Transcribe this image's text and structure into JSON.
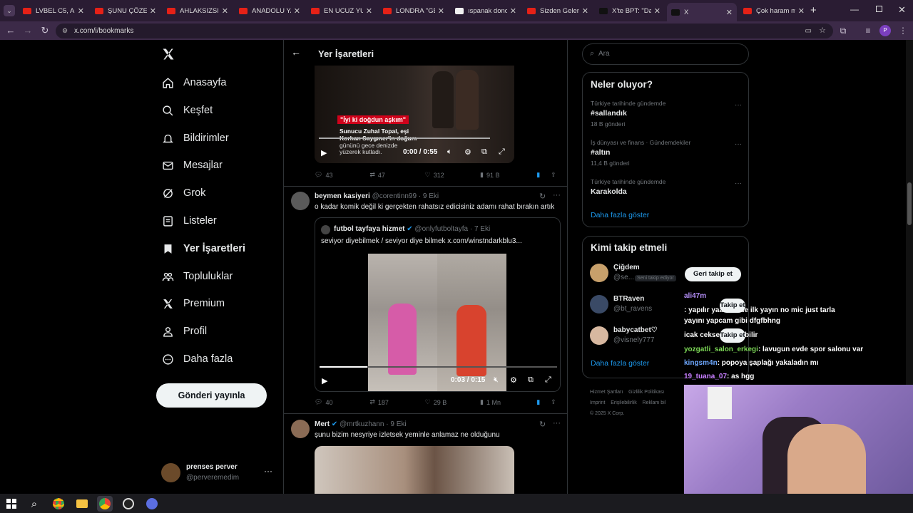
{
  "browser": {
    "tabs": [
      {
        "label": "LVBEL C5, AKD",
        "fav": "#e62117"
      },
      {
        "label": "ŞUNU ÇÖZEBİ",
        "fav": "#e62117"
      },
      {
        "label": "AHLAKSIZSINI",
        "fav": "#e62117"
      },
      {
        "label": "ANADOLU YAK",
        "fav": "#e62117"
      },
      {
        "label": "EN UCUZ YURT",
        "fav": "#e62117"
      },
      {
        "label": "LONDRA \"GEC",
        "fav": "#e62117"
      },
      {
        "label": "ıspanak dondu",
        "fav": "#f1f1f1"
      },
      {
        "label": "Sizden Gelen İ",
        "fav": "#e62117"
      },
      {
        "label": "X'te BPT: \"Davı",
        "fav": "#111111"
      },
      {
        "label": "X",
        "fav": "#111111"
      },
      {
        "label": "Çok haram mı",
        "fav": "#e62117"
      }
    ],
    "url": "x.com/i/bookmarks",
    "profile_initial": "P"
  },
  "sidebar": {
    "items": [
      {
        "label": "Anasayfa",
        "icon": "home-icon"
      },
      {
        "label": "Keşfet",
        "icon": "search-icon"
      },
      {
        "label": "Bildirimler",
        "icon": "bell-icon"
      },
      {
        "label": "Mesajlar",
        "icon": "mail-icon"
      },
      {
        "label": "Grok",
        "icon": "grok-icon"
      },
      {
        "label": "Listeler",
        "icon": "list-icon"
      },
      {
        "label": "Yer İşaretleri",
        "icon": "bookmark-icon"
      },
      {
        "label": "Topluluklar",
        "icon": "people-icon"
      },
      {
        "label": "Premium",
        "icon": "x-logo-icon"
      },
      {
        "label": "Profil",
        "icon": "profile-icon"
      },
      {
        "label": "Daha fazla",
        "icon": "more-circle-icon"
      }
    ],
    "post_button": "Gönderi yayınla",
    "account": {
      "name": "prenses perver",
      "handle": "@perveremedim"
    }
  },
  "main": {
    "title": "Yer İşaretleri",
    "post1": {
      "image_caption_lines": [
        "\"İyi ki doğdun aşkım\"",
        "Sunucu Zuhal Topal, eşi",
        "Korhan Saygıner'in doğum",
        "gününü gece denizde",
        "yüzerek kutladı."
      ],
      "time": "0:00 / 0:55",
      "stats": {
        "replies": "43",
        "reposts": "47",
        "likes": "312",
        "views": "91 B"
      }
    },
    "post2": {
      "name": "beymen kasiyeri",
      "handle": "@corentinn99",
      "date": "· 9 Eki",
      "text": "o kadar komik değil ki gerçekten rahatsız edicisiniz adamı rahat bırakın artık",
      "quote": {
        "name": "futbol tayfaya hizmet",
        "handle": "@onlyfutboltayfa",
        "date": "· 7 Eki",
        "text": "seviyor diyebilmek / seviyor diye bilmek  x.com/winstndarkblu3..."
      },
      "time": "0:03 / 0:15",
      "stats": {
        "replies": "40",
        "reposts": "187",
        "likes": "29 B",
        "views": "1 Mn"
      }
    },
    "post3": {
      "name": "Mert",
      "handle": "@mrtkuzhann",
      "date": "· 9 Eki",
      "text": "şunu bizim nesyriye izletsek yeminle anlamaz ne olduğunu"
    }
  },
  "right": {
    "search_placeholder": "Ara",
    "trends_title": "Neler oluyor?",
    "trends": [
      {
        "context": "Türkiye tarihinde gündemde",
        "name": "#sallandık",
        "count": "18 B gönderi"
      },
      {
        "context": "İş dünyası ve finans · Gündemdekiler",
        "name": "#altın",
        "count": "11,4 B gönderi"
      },
      {
        "context": "Türkiye tarihinde gündemde",
        "name": "Karakolda",
        "count": ""
      }
    ],
    "trends_more": "Daha fazla göster",
    "follow_title": "Kimi takip etmeli",
    "follow": [
      {
        "name": "Çiğdem",
        "handle": "@se...",
        "badge": "Seni takip ediyor",
        "button": "Geri takip et"
      },
      {
        "name": "BTRaven",
        "handle": "@bt_ravens",
        "badge": "",
        "button": "Takip et"
      },
      {
        "name": "babycatbet♡",
        "handle": "@visnely777",
        "badge": "",
        "button": "Takip et"
      }
    ],
    "follow_more": "Daha fazla göster",
    "footer": [
      "Hizmet Şartları",
      "Gizlilik Politikası",
      "Imprint",
      "Erişilebilirlik",
      "Reklam bil",
      "© 2025 X Corp."
    ]
  },
  "chat": [
    {
      "user": "ali47m",
      "color": "#b38ef7",
      "msg": ""
    },
    {
      "user": "",
      "color": "#5ab0ff",
      "msg": ": yapılır yaa ben de ilk yayın no mic just tarla"
    },
    {
      "user": "",
      "color": "#ffffff",
      "msg": "yayını yapcam gibi dfgfbhng"
    },
    {
      "user": "",
      "color": "#5ab0ff",
      "msg": "icak ceksem napabilir"
    },
    {
      "user": "yozgatli_salon_erkegi",
      "color": "#7cd856",
      "msg": ": lavugun evde spor salonu var"
    },
    {
      "user": "kingsm4n",
      "color": "#6ea8ff",
      "msg": ": popoya şaplağı yakaladın mı"
    },
    {
      "user": "19_tuana_07",
      "color": "#c77dff",
      "msg": ": as hgg"
    }
  ]
}
